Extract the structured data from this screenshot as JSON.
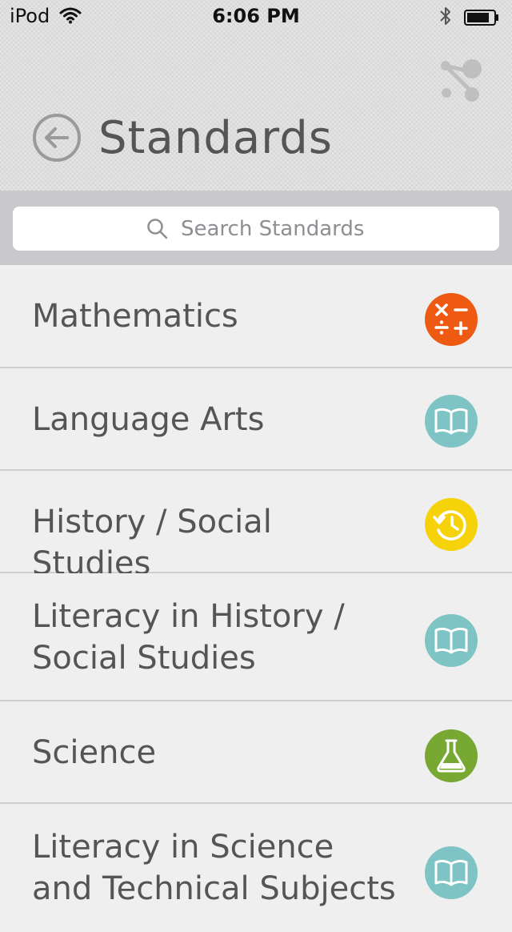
{
  "status_bar": {
    "carrier": "iPod",
    "time": "6:06 PM"
  },
  "header": {
    "title": "Standards",
    "back_icon": "back-arrow-icon",
    "share_icon": "share-icon"
  },
  "search": {
    "placeholder": "Search Standards"
  },
  "subjects": [
    {
      "label": "Mathematics",
      "icon": "math-operators-icon",
      "color": "#ee5a12"
    },
    {
      "label": "Language Arts",
      "icon": "open-book-icon",
      "color": "#7ec4c4"
    },
    {
      "label": "History / Social Studies",
      "icon": "history-clock-icon",
      "color": "#f5d20a"
    },
    {
      "label": "Literacy in History / Social Studies",
      "icon": "open-book-icon",
      "color": "#7ec4c4"
    },
    {
      "label": "Science",
      "icon": "flask-icon",
      "color": "#77a832"
    },
    {
      "label": "Literacy in Science and Technical Subjects",
      "icon": "open-book-icon",
      "color": "#7ec4c4"
    }
  ]
}
